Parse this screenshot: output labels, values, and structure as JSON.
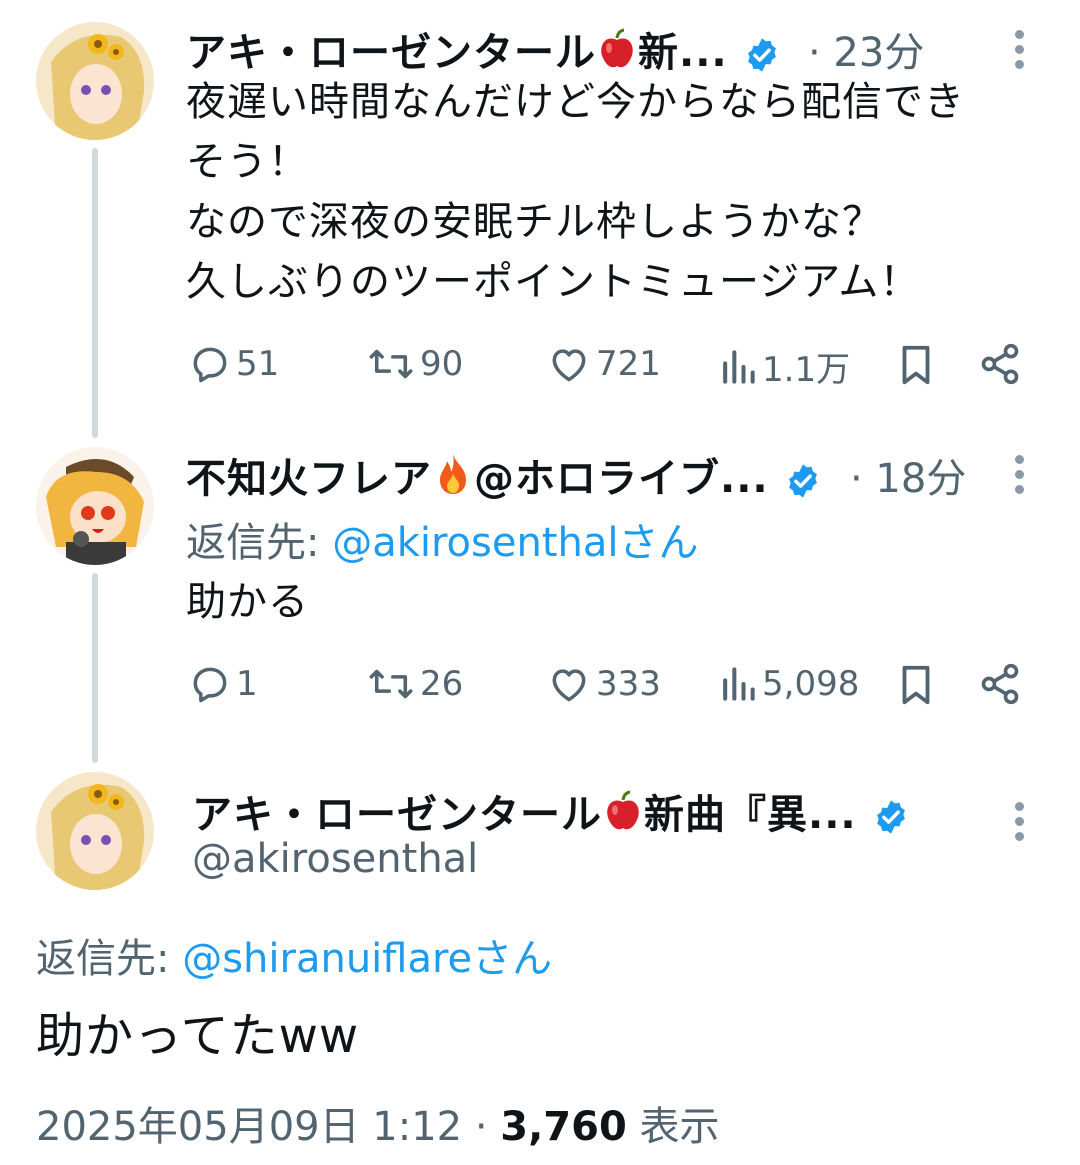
{
  "tweet1": {
    "name": "アキ・ローゼンタール",
    "name_tail": "新...",
    "time": "· 23分",
    "lines": [
      "夜遅い時間なんだけど今からなら配信でき",
      "そう！",
      "なので深夜の安眠チル枠しようかな？",
      "久しぶりのツーポイントミュージアム！"
    ],
    "replies": "51",
    "retweets": "90",
    "likes": "721",
    "views": "1.1万"
  },
  "tweet2": {
    "name": "不知火フレア",
    "name_tail": "@ホロライブ...",
    "time": "· 18分",
    "reply_prefix": "返信先: ",
    "reply_handle": "@akirosenthalさん",
    "text": "助かる",
    "replies": "1",
    "retweets": "26",
    "likes": "333",
    "views": "5,098"
  },
  "main": {
    "name": "アキ・ローゼンタール",
    "name_tail": "新曲『異...",
    "handle": "@akirosenthal",
    "reply_prefix": "返信先: ",
    "reply_handle": "@shiranuiflareさん",
    "text": "助かってたww",
    "date": "2025年05月09日 1:12 · ",
    "view_count": "3,760",
    "view_label": " 表示"
  },
  "icons": [
    "reply-icon",
    "retweet-icon",
    "like-icon",
    "views-icon",
    "bookmark-icon",
    "share-icon",
    "verified-icon",
    "apple-emoji",
    "fire-emoji",
    "more-icon"
  ],
  "colors": {
    "accent": "#1d9bf0",
    "muted": "#536471",
    "text": "#0f1419",
    "line": "#cfd9de"
  }
}
